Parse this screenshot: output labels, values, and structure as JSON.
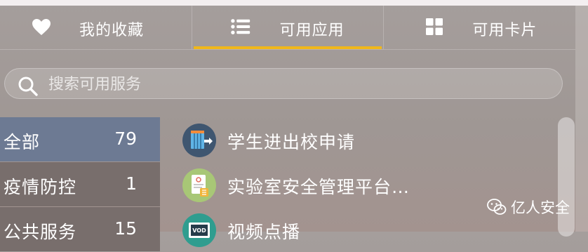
{
  "tabs": [
    {
      "label": "我的收藏",
      "icon": "heart-icon"
    },
    {
      "label": "可用应用",
      "icon": "list-icon",
      "active": true
    },
    {
      "label": "可用卡片",
      "icon": "grid-icon"
    }
  ],
  "search": {
    "placeholder": "搜索可用服务",
    "icon": "search-icon"
  },
  "categories": [
    {
      "name": "全部",
      "count": "79",
      "active": true
    },
    {
      "name": "疫情防控",
      "count": "1"
    },
    {
      "name": "公共服务",
      "count": "15"
    }
  ],
  "apps": [
    {
      "name": "学生进出校申请",
      "icon": "gate-icon"
    },
    {
      "name": "实验室安全管理平台…",
      "icon": "lab-document-icon"
    },
    {
      "name": "视频点播",
      "icon": "vod-icon"
    }
  ],
  "watermark": {
    "text": "亿人安全",
    "icon": "wechat-icon"
  },
  "colors": {
    "accent": "#f0b719",
    "active_category": "#6d7a93",
    "category_bg": "#786e6c"
  }
}
